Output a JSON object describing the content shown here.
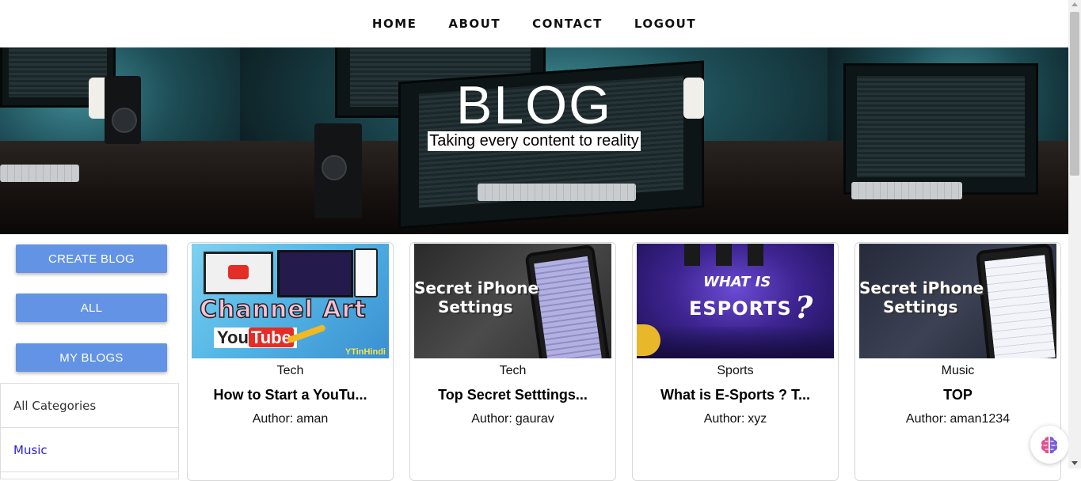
{
  "nav": {
    "items": [
      {
        "label": "HOME"
      },
      {
        "label": "ABOUT"
      },
      {
        "label": "CONTACT"
      },
      {
        "label": "LOGOUT"
      }
    ]
  },
  "hero": {
    "title": "BLOG",
    "subtitle": "Taking every content to reality"
  },
  "sidebar": {
    "buttons": {
      "create": "CREATE BLOG",
      "all": "ALL",
      "my_blogs": "MY BLOGS"
    },
    "categories": [
      {
        "label": "All Categories"
      },
      {
        "label": "Music"
      }
    ]
  },
  "posts": [
    {
      "category": "Tech",
      "title": "How to Start a YouTu...",
      "author_prefix": "Author:",
      "author": "aman",
      "thumb": {
        "line1": "Channel Art",
        "yt_you": "You",
        "yt_tube": "Tube",
        "brand": "YTinHindi"
      }
    },
    {
      "category": "Tech",
      "title": "Top Secret Setttings...",
      "author_prefix": "Author:",
      "author": "gaurav",
      "thumb": {
        "line1": "Secret iPhone",
        "line2": "Settings"
      }
    },
    {
      "category": "Sports",
      "title": "What is E-Sports ? T...",
      "author_prefix": "Author:",
      "author": "xyz",
      "thumb": {
        "line1": "WHAT IS",
        "line2": "ESPORTS",
        "mark": "?"
      }
    },
    {
      "category": "Music",
      "title": "TOP",
      "author_prefix": "Author:",
      "author": "aman1234",
      "thumb": {
        "line1": "Secret iPhone",
        "line2": "Settings"
      }
    }
  ],
  "colors": {
    "button": "#6393e4",
    "category_link": "#2a1fd6",
    "youtube_red": "#e52d27"
  },
  "icons": {
    "fab": "brain-icon"
  }
}
